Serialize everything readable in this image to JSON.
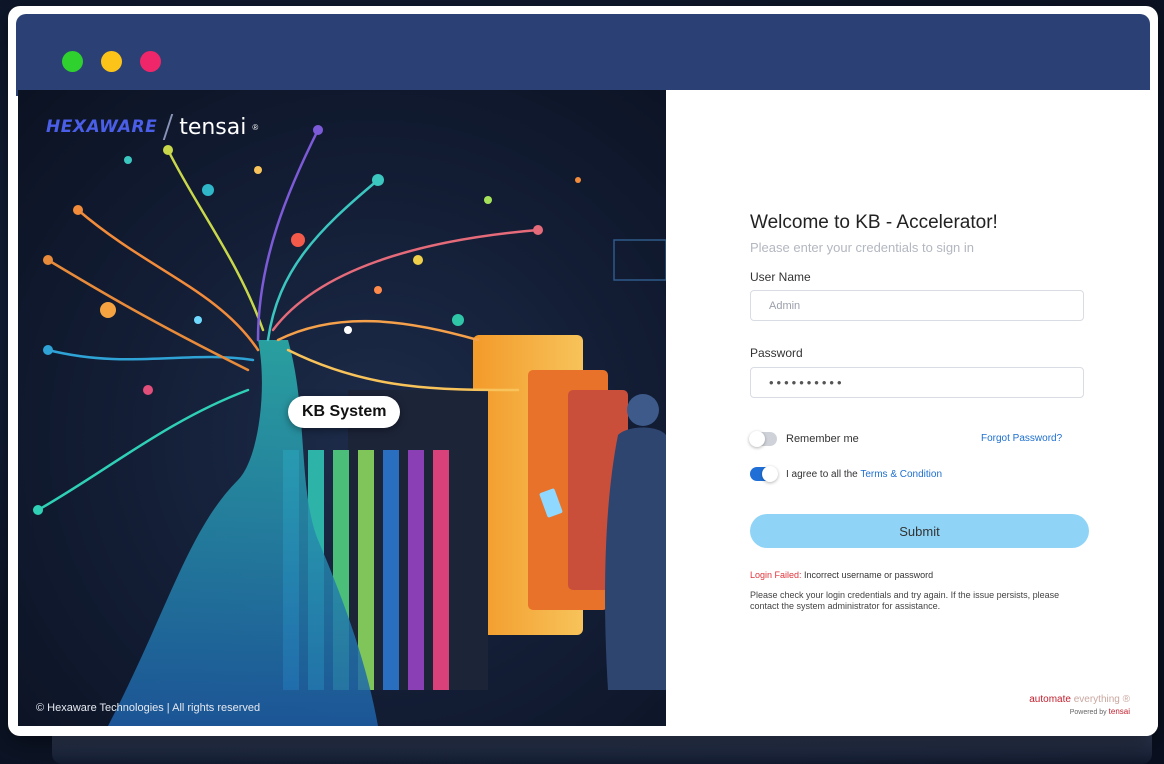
{
  "window": {
    "controls": [
      "close-dot",
      "minimize-dot",
      "maximize-dot"
    ]
  },
  "hero": {
    "brand_hexaware": "HEXAWARE",
    "brand_tensai": "tensai",
    "brand_reg": "®",
    "pill_label": "KB System",
    "copyright": "© Hexaware Technologies | All rights reserved"
  },
  "login": {
    "title": "Welcome to KB - Accelerator!",
    "subtitle": "Please enter your credentials to sign in",
    "username_label": "User Name",
    "username_placeholder": "Admin",
    "password_label": "Password",
    "password_value": "••••••••••",
    "remember_label": "Remember me",
    "remember_checked": false,
    "forgot_link": "Forgot Password?",
    "agree_prefix": "I agree to all the ",
    "agree_link": "Terms & Condition",
    "agree_checked": true,
    "submit_label": "Submit",
    "error_title": "Login Failed:",
    "error_message": " Incorrect username or password",
    "error_help": "Please check your login credentials and try again. If the issue persists, please contact the system administrator for assistance."
  },
  "footer": {
    "tagline_a": "automate",
    "tagline_b": " everything ®",
    "powered_by": "Powered by ",
    "powered_brand": "tensai"
  },
  "colors": {
    "titlebar": "#2b4074",
    "accent": "#1f6fd6",
    "submit": "#8fd4f7",
    "error": "#e0343a"
  }
}
